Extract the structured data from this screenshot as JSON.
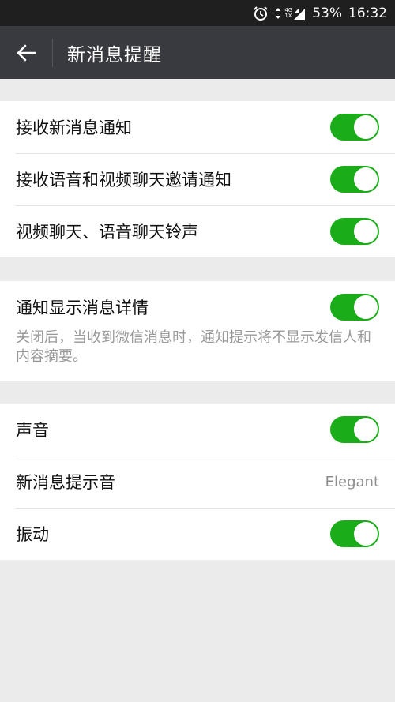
{
  "status_bar": {
    "battery": "53%",
    "time": "16:32",
    "network_top": "4G",
    "network_bottom": "1X",
    "icons": [
      "alarm-icon",
      "data-arrows-icon",
      "signal-icon"
    ]
  },
  "app_bar": {
    "title": "新消息提醒",
    "back_icon": "arrow-left-icon"
  },
  "colors": {
    "switch_on": "#1aad19",
    "app_bar": "#393a3f",
    "status_bar": "#1f1f1f",
    "background": "#ebebeb"
  },
  "section1": {
    "items": [
      {
        "label": "接收新消息通知",
        "switch_on": true
      },
      {
        "label": "接收语音和视频聊天邀请通知",
        "switch_on": true
      },
      {
        "label": "视频聊天、语音聊天铃声",
        "switch_on": true
      }
    ]
  },
  "section2": {
    "label": "通知显示消息详情",
    "switch_on": true,
    "description": "关闭后，当收到微信消息时，通知提示将不显示发信人和内容摘要。"
  },
  "section3": {
    "sound": {
      "label": "声音",
      "switch_on": true
    },
    "ringtone": {
      "label": "新消息提示音",
      "value": "Elegant"
    },
    "vibrate": {
      "label": "振动",
      "switch_on": true
    }
  }
}
